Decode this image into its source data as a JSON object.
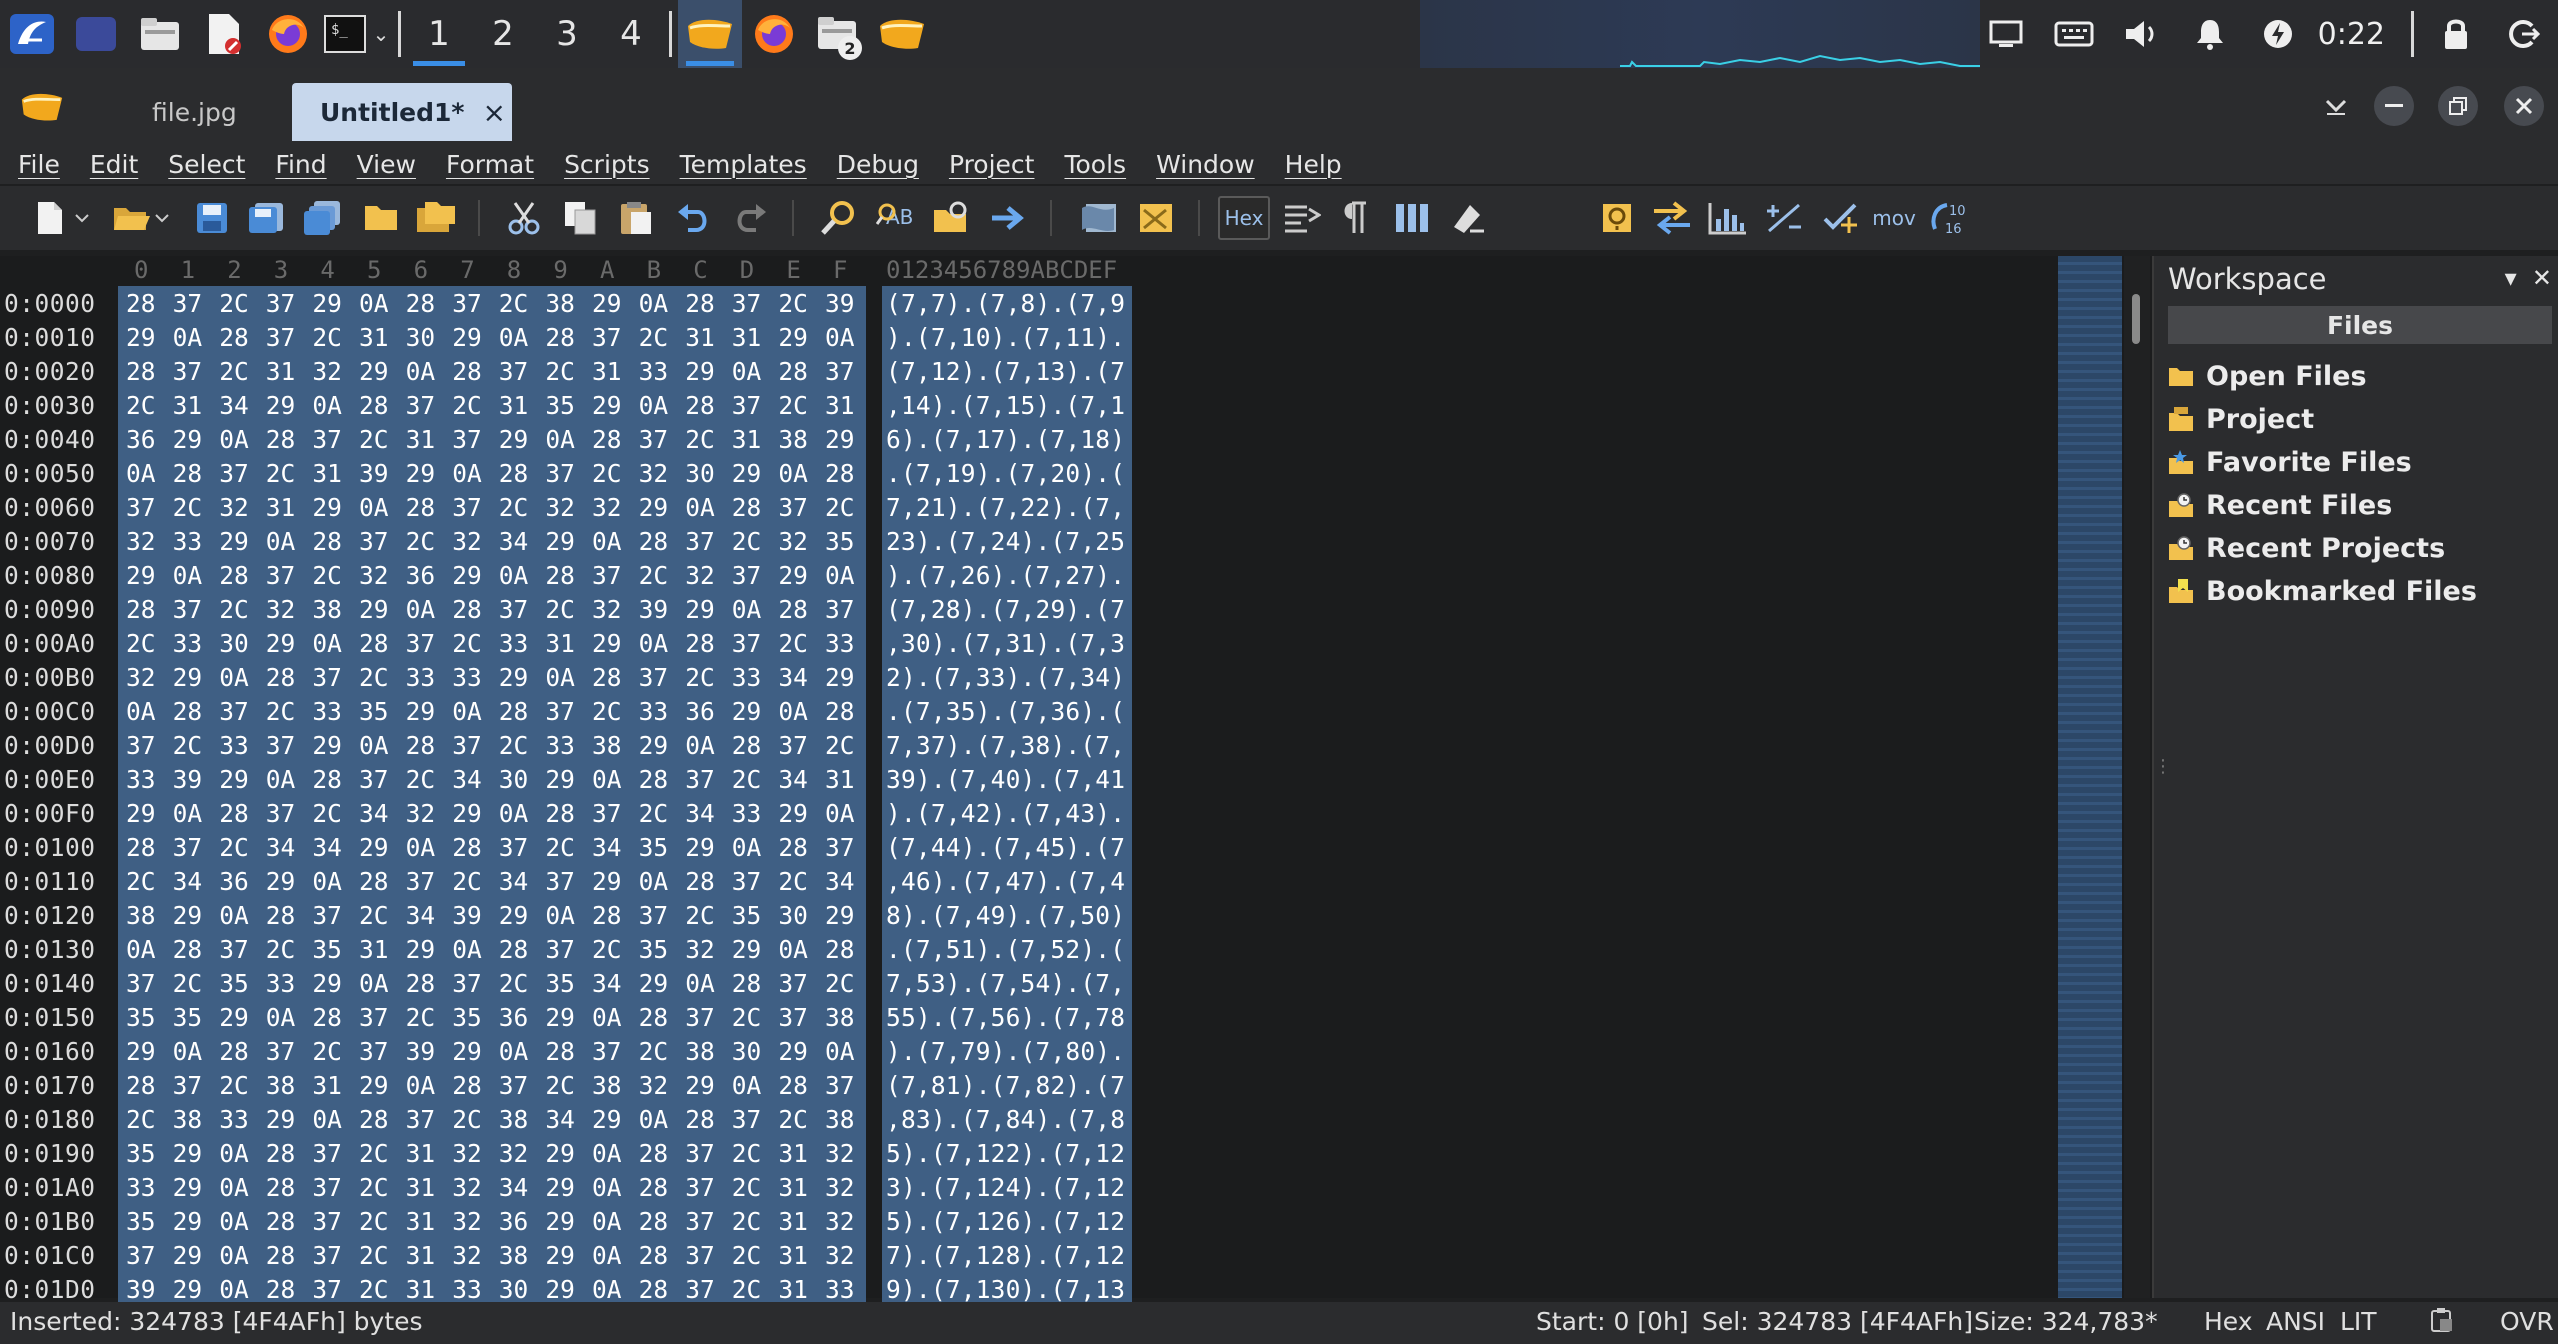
{
  "taskbar": {
    "workspaces": [
      "1",
      "2",
      "3",
      "4"
    ],
    "active_workspace": "1",
    "files_badge": "2",
    "clock": "0:22"
  },
  "app": {
    "tabs": [
      {
        "label": "file.jpg",
        "active": false
      },
      {
        "label": "Untitled1*",
        "active": true
      }
    ],
    "close_tab": "×"
  },
  "menu": [
    "File",
    "Edit",
    "Select",
    "Find",
    "View",
    "Format",
    "Scripts",
    "Templates",
    "Debug",
    "Project",
    "Tools",
    "Window",
    "Help"
  ],
  "toolbar": {
    "hex_label": "Hex",
    "mov_label": "mov",
    "conv_label": "10\n16"
  },
  "editor": {
    "hex_columns": [
      "0",
      "1",
      "2",
      "3",
      "4",
      "5",
      "6",
      "7",
      "8",
      "9",
      "A",
      "B",
      "C",
      "D",
      "E",
      "F"
    ],
    "ascii_header": "0123456789ABCDEF",
    "rows": [
      {
        "off": "0:0000",
        "b": [
          "28",
          "37",
          "2C",
          "37",
          "29",
          "0A",
          "28",
          "37",
          "2C",
          "38",
          "29",
          "0A",
          "28",
          "37",
          "2C",
          "39"
        ],
        "a": "(7,7).(7,8).(7,9"
      },
      {
        "off": "0:0010",
        "b": [
          "29",
          "0A",
          "28",
          "37",
          "2C",
          "31",
          "30",
          "29",
          "0A",
          "28",
          "37",
          "2C",
          "31",
          "31",
          "29",
          "0A"
        ],
        "a": ").(7,10).(7,11)."
      },
      {
        "off": "0:0020",
        "b": [
          "28",
          "37",
          "2C",
          "31",
          "32",
          "29",
          "0A",
          "28",
          "37",
          "2C",
          "31",
          "33",
          "29",
          "0A",
          "28",
          "37"
        ],
        "a": "(7,12).(7,13).(7"
      },
      {
        "off": "0:0030",
        "b": [
          "2C",
          "31",
          "34",
          "29",
          "0A",
          "28",
          "37",
          "2C",
          "31",
          "35",
          "29",
          "0A",
          "28",
          "37",
          "2C",
          "31"
        ],
        "a": ",14).(7,15).(7,1"
      },
      {
        "off": "0:0040",
        "b": [
          "36",
          "29",
          "0A",
          "28",
          "37",
          "2C",
          "31",
          "37",
          "29",
          "0A",
          "28",
          "37",
          "2C",
          "31",
          "38",
          "29"
        ],
        "a": "6).(7,17).(7,18)"
      },
      {
        "off": "0:0050",
        "b": [
          "0A",
          "28",
          "37",
          "2C",
          "31",
          "39",
          "29",
          "0A",
          "28",
          "37",
          "2C",
          "32",
          "30",
          "29",
          "0A",
          "28"
        ],
        "a": ".(7,19).(7,20).("
      },
      {
        "off": "0:0060",
        "b": [
          "37",
          "2C",
          "32",
          "31",
          "29",
          "0A",
          "28",
          "37",
          "2C",
          "32",
          "32",
          "29",
          "0A",
          "28",
          "37",
          "2C"
        ],
        "a": "7,21).(7,22).(7,"
      },
      {
        "off": "0:0070",
        "b": [
          "32",
          "33",
          "29",
          "0A",
          "28",
          "37",
          "2C",
          "32",
          "34",
          "29",
          "0A",
          "28",
          "37",
          "2C",
          "32",
          "35"
        ],
        "a": "23).(7,24).(7,25"
      },
      {
        "off": "0:0080",
        "b": [
          "29",
          "0A",
          "28",
          "37",
          "2C",
          "32",
          "36",
          "29",
          "0A",
          "28",
          "37",
          "2C",
          "32",
          "37",
          "29",
          "0A"
        ],
        "a": ").(7,26).(7,27)."
      },
      {
        "off": "0:0090",
        "b": [
          "28",
          "37",
          "2C",
          "32",
          "38",
          "29",
          "0A",
          "28",
          "37",
          "2C",
          "32",
          "39",
          "29",
          "0A",
          "28",
          "37"
        ],
        "a": "(7,28).(7,29).(7"
      },
      {
        "off": "0:00A0",
        "b": [
          "2C",
          "33",
          "30",
          "29",
          "0A",
          "28",
          "37",
          "2C",
          "33",
          "31",
          "29",
          "0A",
          "28",
          "37",
          "2C",
          "33"
        ],
        "a": ",30).(7,31).(7,3"
      },
      {
        "off": "0:00B0",
        "b": [
          "32",
          "29",
          "0A",
          "28",
          "37",
          "2C",
          "33",
          "33",
          "29",
          "0A",
          "28",
          "37",
          "2C",
          "33",
          "34",
          "29"
        ],
        "a": "2).(7,33).(7,34)"
      },
      {
        "off": "0:00C0",
        "b": [
          "0A",
          "28",
          "37",
          "2C",
          "33",
          "35",
          "29",
          "0A",
          "28",
          "37",
          "2C",
          "33",
          "36",
          "29",
          "0A",
          "28"
        ],
        "a": ".(7,35).(7,36).("
      },
      {
        "off": "0:00D0",
        "b": [
          "37",
          "2C",
          "33",
          "37",
          "29",
          "0A",
          "28",
          "37",
          "2C",
          "33",
          "38",
          "29",
          "0A",
          "28",
          "37",
          "2C"
        ],
        "a": "7,37).(7,38).(7,"
      },
      {
        "off": "0:00E0",
        "b": [
          "33",
          "39",
          "29",
          "0A",
          "28",
          "37",
          "2C",
          "34",
          "30",
          "29",
          "0A",
          "28",
          "37",
          "2C",
          "34",
          "31"
        ],
        "a": "39).(7,40).(7,41"
      },
      {
        "off": "0:00F0",
        "b": [
          "29",
          "0A",
          "28",
          "37",
          "2C",
          "34",
          "32",
          "29",
          "0A",
          "28",
          "37",
          "2C",
          "34",
          "33",
          "29",
          "0A"
        ],
        "a": ").(7,42).(7,43)."
      },
      {
        "off": "0:0100",
        "b": [
          "28",
          "37",
          "2C",
          "34",
          "34",
          "29",
          "0A",
          "28",
          "37",
          "2C",
          "34",
          "35",
          "29",
          "0A",
          "28",
          "37"
        ],
        "a": "(7,44).(7,45).(7"
      },
      {
        "off": "0:0110",
        "b": [
          "2C",
          "34",
          "36",
          "29",
          "0A",
          "28",
          "37",
          "2C",
          "34",
          "37",
          "29",
          "0A",
          "28",
          "37",
          "2C",
          "34"
        ],
        "a": ",46).(7,47).(7,4"
      },
      {
        "off": "0:0120",
        "b": [
          "38",
          "29",
          "0A",
          "28",
          "37",
          "2C",
          "34",
          "39",
          "29",
          "0A",
          "28",
          "37",
          "2C",
          "35",
          "30",
          "29"
        ],
        "a": "8).(7,49).(7,50)"
      },
      {
        "off": "0:0130",
        "b": [
          "0A",
          "28",
          "37",
          "2C",
          "35",
          "31",
          "29",
          "0A",
          "28",
          "37",
          "2C",
          "35",
          "32",
          "29",
          "0A",
          "28"
        ],
        "a": ".(7,51).(7,52).("
      },
      {
        "off": "0:0140",
        "b": [
          "37",
          "2C",
          "35",
          "33",
          "29",
          "0A",
          "28",
          "37",
          "2C",
          "35",
          "34",
          "29",
          "0A",
          "28",
          "37",
          "2C"
        ],
        "a": "7,53).(7,54).(7,"
      },
      {
        "off": "0:0150",
        "b": [
          "35",
          "35",
          "29",
          "0A",
          "28",
          "37",
          "2C",
          "35",
          "36",
          "29",
          "0A",
          "28",
          "37",
          "2C",
          "37",
          "38"
        ],
        "a": "55).(7,56).(7,78"
      },
      {
        "off": "0:0160",
        "b": [
          "29",
          "0A",
          "28",
          "37",
          "2C",
          "37",
          "39",
          "29",
          "0A",
          "28",
          "37",
          "2C",
          "38",
          "30",
          "29",
          "0A"
        ],
        "a": ").(7,79).(7,80)."
      },
      {
        "off": "0:0170",
        "b": [
          "28",
          "37",
          "2C",
          "38",
          "31",
          "29",
          "0A",
          "28",
          "37",
          "2C",
          "38",
          "32",
          "29",
          "0A",
          "28",
          "37"
        ],
        "a": "(7,81).(7,82).(7"
      },
      {
        "off": "0:0180",
        "b": [
          "2C",
          "38",
          "33",
          "29",
          "0A",
          "28",
          "37",
          "2C",
          "38",
          "34",
          "29",
          "0A",
          "28",
          "37",
          "2C",
          "38"
        ],
        "a": ",83).(7,84).(7,8"
      },
      {
        "off": "0:0190",
        "b": [
          "35",
          "29",
          "0A",
          "28",
          "37",
          "2C",
          "31",
          "32",
          "32",
          "29",
          "0A",
          "28",
          "37",
          "2C",
          "31",
          "32"
        ],
        "a": "5).(7,122).(7,12"
      },
      {
        "off": "0:01A0",
        "b": [
          "33",
          "29",
          "0A",
          "28",
          "37",
          "2C",
          "31",
          "32",
          "34",
          "29",
          "0A",
          "28",
          "37",
          "2C",
          "31",
          "32"
        ],
        "a": "3).(7,124).(7,12"
      },
      {
        "off": "0:01B0",
        "b": [
          "35",
          "29",
          "0A",
          "28",
          "37",
          "2C",
          "31",
          "32",
          "36",
          "29",
          "0A",
          "28",
          "37",
          "2C",
          "31",
          "32"
        ],
        "a": "5).(7,126).(7,12"
      },
      {
        "off": "0:01C0",
        "b": [
          "37",
          "29",
          "0A",
          "28",
          "37",
          "2C",
          "31",
          "32",
          "38",
          "29",
          "0A",
          "28",
          "37",
          "2C",
          "31",
          "32"
        ],
        "a": "7).(7,128).(7,12"
      },
      {
        "off": "0:01D0",
        "b": [
          "39",
          "29",
          "0A",
          "28",
          "37",
          "2C",
          "31",
          "33",
          "30",
          "29",
          "0A",
          "28",
          "37",
          "2C",
          "31",
          "33"
        ],
        "a": "9).(7,130).(7,13"
      }
    ]
  },
  "workspace": {
    "title": "Workspace",
    "section": "Files",
    "items": [
      "Open Files",
      "Project",
      "Favorite Files",
      "Recent Files",
      "Recent Projects",
      "Bookmarked Files"
    ]
  },
  "status": {
    "message": "Inserted: 324783 [4F4AFh] bytes",
    "start": "Start: 0 [0h]",
    "sel": "Sel: 324783 [4F4AFh]",
    "size": "Size: 324,783*",
    "mode_hex": "Hex",
    "encoding": "ANSI",
    "endian": "LIT",
    "overwrite": "OVR"
  },
  "colors": {
    "selection": "#3f5f84",
    "active_tab": "#c7d7ec",
    "accent": "#3a8ee6"
  }
}
